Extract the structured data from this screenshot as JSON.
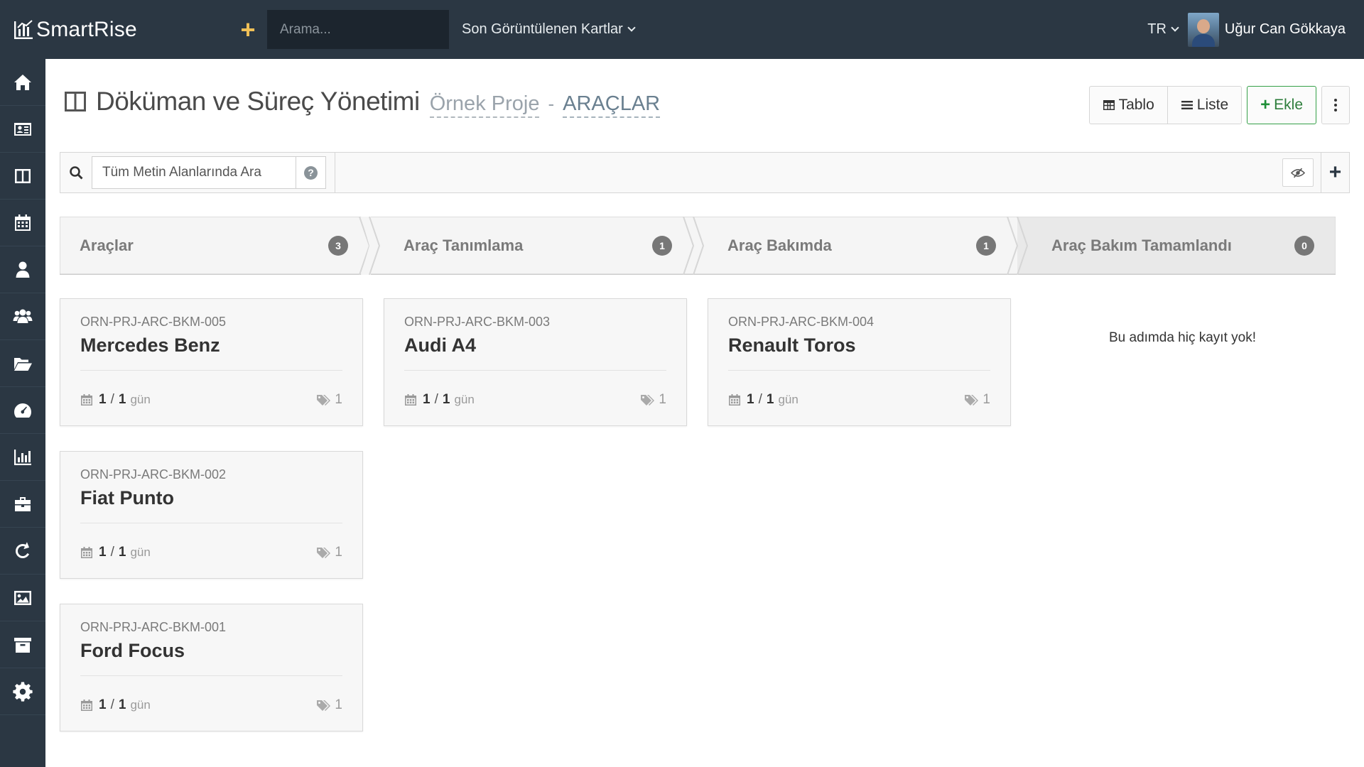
{
  "app": {
    "brand": "SmartRise",
    "quick_add": "+",
    "search_placeholder": "Arama...",
    "recent_label": "Son Görüntülenen Kartlar",
    "lang": "TR",
    "user_name": "Uğur Can Gökkaya"
  },
  "sidebar": {
    "items": [
      {
        "name": "home",
        "icon": "home-icon"
      },
      {
        "name": "contacts",
        "icon": "id-card-icon"
      },
      {
        "name": "board",
        "icon": "columns-icon"
      },
      {
        "name": "calendar",
        "icon": "calendar-icon"
      },
      {
        "name": "user",
        "icon": "user-icon"
      },
      {
        "name": "team",
        "icon": "users-icon"
      },
      {
        "name": "files",
        "icon": "folder-open-icon"
      },
      {
        "name": "dashboard",
        "icon": "dashboard-icon"
      },
      {
        "name": "reports",
        "icon": "bar-chart-icon"
      },
      {
        "name": "projects",
        "icon": "briefcase-icon"
      },
      {
        "name": "sync",
        "icon": "refresh-icon"
      },
      {
        "name": "gallery",
        "icon": "image-icon"
      },
      {
        "name": "archive",
        "icon": "archive-icon"
      },
      {
        "name": "settings",
        "icon": "gear-icon"
      }
    ]
  },
  "header": {
    "title": "Döküman ve Süreç Yönetimi",
    "project": "Örnek Proje",
    "separator": "-",
    "category": "ARAÇLAR"
  },
  "toolbar": {
    "table_label": "Tablo",
    "list_label": "Liste",
    "add_label": "Ekle"
  },
  "filter": {
    "placeholder": "Tüm Metin Alanlarında Ara",
    "help": "?"
  },
  "stages": [
    {
      "label": "Araçlar",
      "count": "3"
    },
    {
      "label": "Araç Tanımlama",
      "count": "1"
    },
    {
      "label": "Araç Bakımda",
      "count": "1"
    },
    {
      "label": "Araç Bakım Tamamlandı",
      "count": "0"
    }
  ],
  "cards": [
    {
      "code": "ORN-PRJ-ARC-BKM-005",
      "title": "Mercedes Benz",
      "done": "1",
      "sep": "/",
      "total": "1",
      "unit": "gün",
      "tags": "1"
    },
    {
      "code": "ORN-PRJ-ARC-BKM-002",
      "title": "Fiat Punto",
      "done": "1",
      "sep": "/",
      "total": "1",
      "unit": "gün",
      "tags": "1"
    },
    {
      "code": "ORN-PRJ-ARC-BKM-001",
      "title": "Ford Focus",
      "done": "1",
      "sep": "/",
      "total": "1",
      "unit": "gün",
      "tags": "1"
    },
    {
      "code": "ORN-PRJ-ARC-BKM-003",
      "title": "Audi A4",
      "done": "1",
      "sep": "/",
      "total": "1",
      "unit": "gün",
      "tags": "1"
    },
    {
      "code": "ORN-PRJ-ARC-BKM-004",
      "title": "Renault Toros",
      "done": "1",
      "sep": "/",
      "total": "1",
      "unit": "gün",
      "tags": "1"
    }
  ],
  "empty_message": "Bu adımda hiç kayıt yok!",
  "colors": {
    "topbar": "#2b3743",
    "accent_add": "#f0c057",
    "success": "#35a048"
  }
}
